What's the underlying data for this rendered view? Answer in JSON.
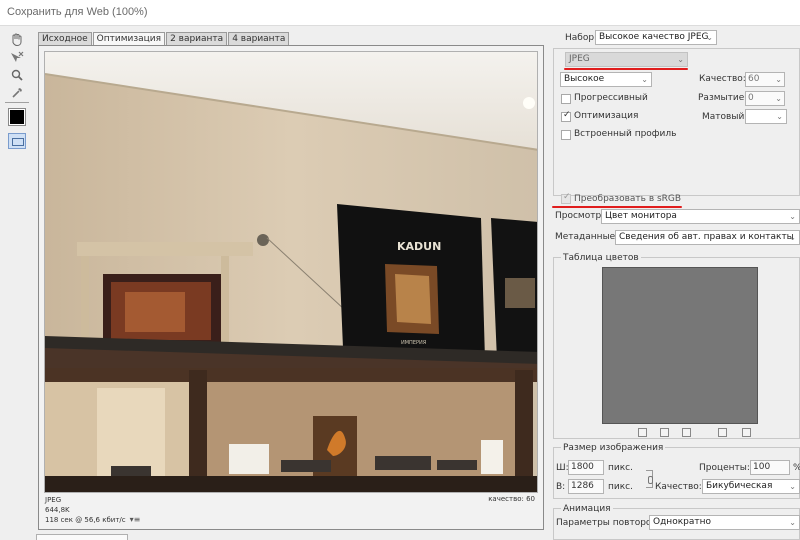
{
  "window": {
    "title": "Сохранить для Web (100%)"
  },
  "tools": [
    {
      "name": "hand-tool-icon"
    },
    {
      "name": "slice-select-tool-icon"
    },
    {
      "name": "zoom-tool-icon"
    },
    {
      "name": "eyedropper-tool-icon"
    }
  ],
  "tabs": [
    "Исходное",
    "Оптимизация",
    "2 варианта",
    "4 варианта"
  ],
  "active_tab": "Оптимизация",
  "preview": {
    "format": "JPEG",
    "size": "644,8K",
    "time": "118 сек @ 56,6 кбит/с",
    "menu_glyph": "▾≡",
    "quality": "качество: 60",
    "photo_text": {
      "brand": "KADUN",
      "sub": "ИМПЕРИЯ"
    }
  },
  "settings": {
    "preset_label": "Набор:",
    "preset_value": "Высокое качество JPEG",
    "format_value": "JPEG",
    "quality_preset": "Высокое",
    "quality_label": "Качество:",
    "quality_value": "60",
    "progressive_label": "Прогрессивный",
    "progressive_checked": false,
    "blur_label": "Размытие:",
    "blur_value": "0",
    "optimized_label": "Оптимизация",
    "optimized_checked": true,
    "matte_label": "Матовый:",
    "matte_value": "",
    "embed_profile_label": "Встроенный профиль",
    "embed_profile_checked": false,
    "convert_srgb_label": "Преобразовать в sRGB",
    "convert_srgb_checked": true,
    "preview_label": "Просмотр:",
    "preview_value": "Цвет монитора",
    "metadata_label": "Метаданные:",
    "metadata_value": "Сведения об авт. правах и контакты"
  },
  "color_table": {
    "title": "Таблица цветов",
    "color": "#777777"
  },
  "image_size": {
    "title": "Размер изображения",
    "w_label": "Ш:",
    "w_value": "1800",
    "h_label": "В:",
    "h_value": "1286",
    "unit": "пикс.",
    "percent_label": "Проценты:",
    "percent_value": "100",
    "percent_unit": "%",
    "quality_label": "Качество:",
    "quality_value": "Бикубическая"
  },
  "animation": {
    "title": "Анимация",
    "loop_label": "Параметры повторов:",
    "loop_value": "Однократно"
  },
  "annotations_color": "#e01d1d"
}
